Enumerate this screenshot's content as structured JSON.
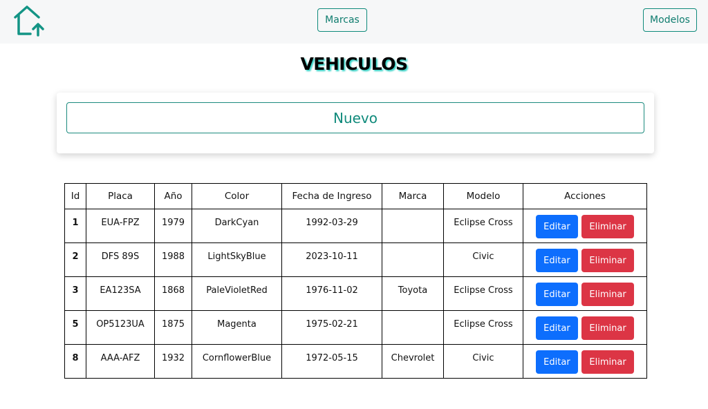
{
  "nav": {
    "marcas_label": "Marcas",
    "modelos_label": "Modelos",
    "home_icon": "home-upload-icon"
  },
  "page": {
    "title": "VEHICULOS",
    "new_button_label": "Nuevo"
  },
  "table": {
    "headers": [
      "Id",
      "Placa",
      "Año",
      "Color",
      "Fecha de Ingreso",
      "Marca",
      "Modelo",
      "Acciones"
    ],
    "edit_label": "Editar",
    "delete_label": "Eliminar",
    "rows": [
      {
        "id": "1",
        "placa": "EUA-FPZ",
        "anio": "1979",
        "color": "DarkCyan",
        "fecha": "1992-03-29",
        "marca": "",
        "modelo": "Eclipse Cross"
      },
      {
        "id": "2",
        "placa": "DFS 89S",
        "anio": "1988",
        "color": "LightSkyBlue",
        "fecha": "2023-10-11",
        "marca": "",
        "modelo": "Civic"
      },
      {
        "id": "3",
        "placa": "EA123SA",
        "anio": "1868",
        "color": "PaleVioletRed",
        "fecha": "1976-11-02",
        "marca": "Toyota",
        "modelo": "Eclipse Cross"
      },
      {
        "id": "5",
        "placa": "OP5123UA",
        "anio": "1875",
        "color": "Magenta",
        "fecha": "1975-02-21",
        "marca": "",
        "modelo": "Eclipse Cross"
      },
      {
        "id": "8",
        "placa": "AAA-AFZ",
        "anio": "1932",
        "color": "CornflowerBlue",
        "fecha": "1972-05-15",
        "marca": "Chevrolet",
        "modelo": "Civic"
      }
    ]
  },
  "colors": {
    "accent": "#0e8a7b",
    "edit": "#0d6efd",
    "delete": "#dc3545"
  }
}
